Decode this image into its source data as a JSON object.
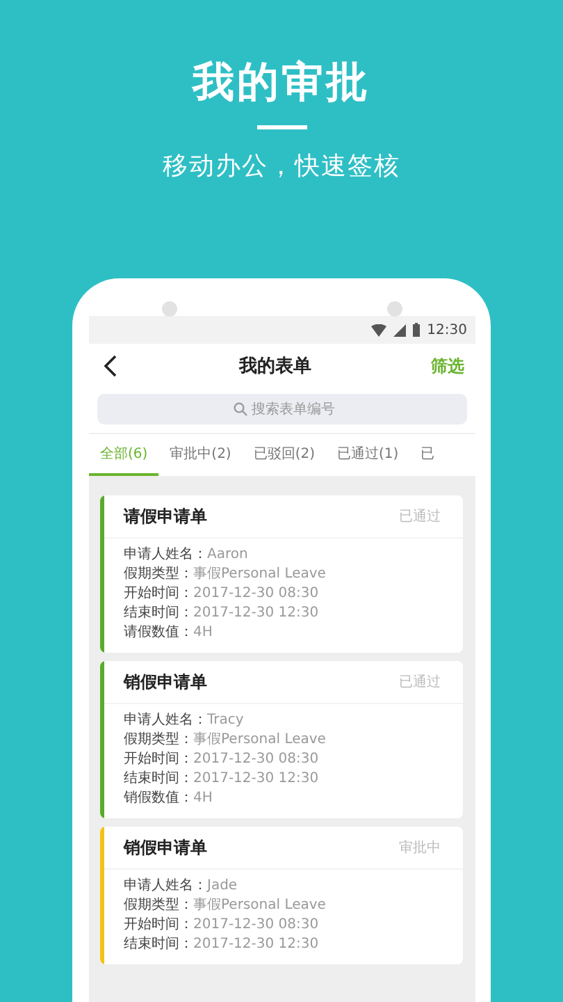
{
  "header": {
    "title": "我的审批",
    "subtitle": "移动办公，快速签核"
  },
  "status_bar": {
    "time": "12:30"
  },
  "app_bar": {
    "title": "我的表单",
    "action": "筛选"
  },
  "search": {
    "placeholder": "搜索表单编号"
  },
  "tabs": [
    {
      "label": "全部(6)",
      "selected": true
    },
    {
      "label": "审批中(2)",
      "selected": false
    },
    {
      "label": "已驳回(2)",
      "selected": false
    },
    {
      "label": "已通过(1)",
      "selected": false
    },
    {
      "label": "已",
      "selected": false
    }
  ],
  "cards": [
    {
      "title": "请假申请单",
      "status": "已通过",
      "color": "#5aab2b",
      "fields": [
        {
          "label": "申请人姓名：",
          "value": "Aaron"
        },
        {
          "label": "假期类型：",
          "value": "事假Personal Leave"
        },
        {
          "label": "开始时间：",
          "value": "2017-12-30 08:30"
        },
        {
          "label": "结束时间：",
          "value": "2017-12-30 12:30"
        },
        {
          "label": "请假数值：",
          "value": "4H"
        }
      ]
    },
    {
      "title": "销假申请单",
      "status": "已通过",
      "color": "#5aab2b",
      "fields": [
        {
          "label": "申请人姓名：",
          "value": "Tracy"
        },
        {
          "label": "假期类型：",
          "value": "事假Personal Leave"
        },
        {
          "label": "开始时间：",
          "value": "2017-12-30 08:30"
        },
        {
          "label": "结束时间：",
          "value": "2017-12-30 12:30"
        },
        {
          "label": "销假数值：",
          "value": "4H"
        }
      ]
    },
    {
      "title": "销假申请单",
      "status": "审批中",
      "color": "#f2c318",
      "fields": [
        {
          "label": "申请人姓名：",
          "value": "Jade"
        },
        {
          "label": "假期类型：",
          "value": "事假Personal Leave"
        },
        {
          "label": "开始时间：",
          "value": "2017-12-30 08:30"
        },
        {
          "label": "结束时间：",
          "value": "2017-12-30 12:30"
        }
      ]
    }
  ]
}
